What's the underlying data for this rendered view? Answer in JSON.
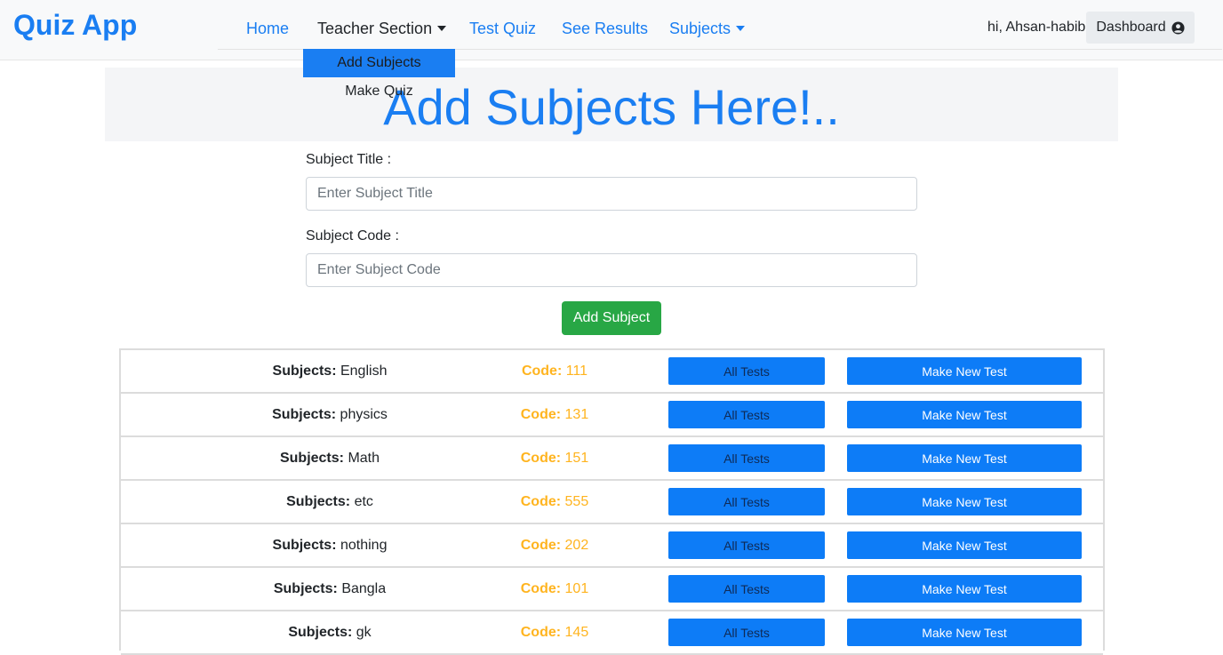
{
  "navbar": {
    "brand": "Quiz App",
    "links": {
      "home": "Home",
      "teacher_section": "Teacher Section",
      "test_quiz": "Test Quiz",
      "see_results": "See Results",
      "subjects": "Subjects"
    },
    "greeting": "hi, Ahsan-habib",
    "dashboard_label": "Dashboard",
    "dashboard_icon": "user-circle-icon"
  },
  "dropdown": {
    "items": [
      "Add Subjects",
      "Make Quiz"
    ],
    "active_item": "Add Subjects"
  },
  "jumbotron": {
    "title": "Add Subjects Here!.."
  },
  "form": {
    "title_label": "Subject Title :",
    "title_placeholder": "Enter Subject Title",
    "code_label": "Subject Code :",
    "code_placeholder": "Enter Subject Code",
    "submit_label": "Add Subject"
  },
  "table": {
    "subject_prefix": "Subjects:",
    "code_prefix": "Code:",
    "all_tests_label": "All Tests",
    "make_test_label": "Make New Test",
    "rows": [
      {
        "subject": "English",
        "code": "111"
      },
      {
        "subject": "physics",
        "code": "131"
      },
      {
        "subject": "Math",
        "code": "151"
      },
      {
        "subject": "etc",
        "code": "555"
      },
      {
        "subject": "nothing",
        "code": "202"
      },
      {
        "subject": "Bangla",
        "code": "101"
      },
      {
        "subject": "gk",
        "code": "145"
      }
    ]
  },
  "colors": {
    "primary": "#1a7ef2",
    "success": "#28a745",
    "code_accent": "#ffb41f",
    "navbar_bg": "#f8f9fa"
  }
}
